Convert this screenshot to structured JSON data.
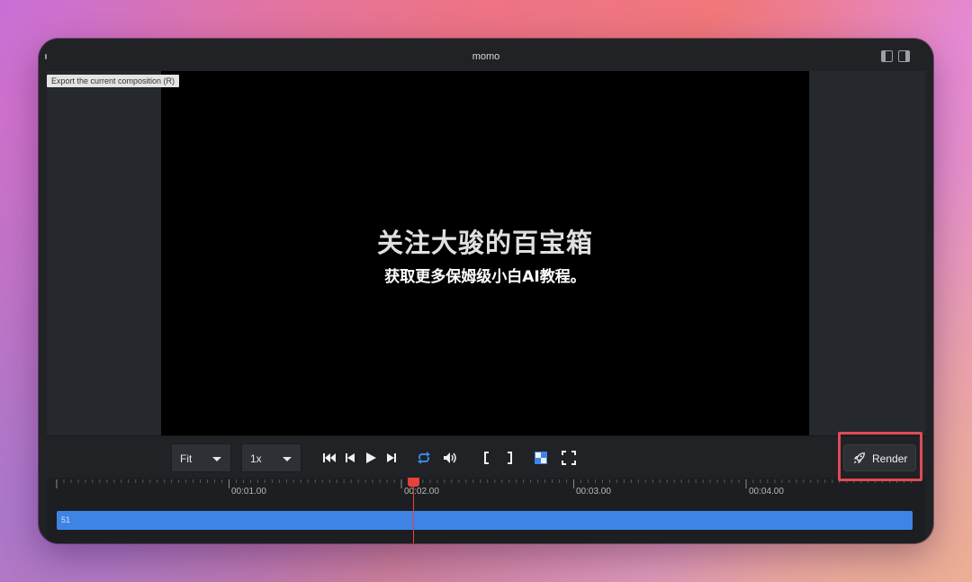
{
  "window": {
    "title": "momo"
  },
  "tooltip": {
    "text": "Export the current composition (R)"
  },
  "preview": {
    "title": "关注大骏的百宝箱",
    "subtitle": "获取更多保姆级小白AI教程。"
  },
  "controls": {
    "size_select": "Fit",
    "speed_select": "1x",
    "render_label": "Render",
    "accent_color": "#3f84e5"
  },
  "timeline": {
    "ticks": [
      "00:01.00",
      "00:02.00",
      "00:03.00",
      "00:04.00"
    ],
    "track_label": "51",
    "track_color": "#3f84e5",
    "playhead_color": "#e5433a"
  },
  "icons": {
    "layout_left": "sidebar-left-icon",
    "layout_right": "sidebar-right-icon",
    "first_frame": "skip-to-start-icon",
    "prev_frame": "step-back-icon",
    "play": "play-icon",
    "next_frame": "step-forward-icon",
    "loop": "loop-icon",
    "volume": "volume-icon",
    "in_point": "in-point-bracket-icon",
    "out_point": "out-point-bracket-icon",
    "checkerboard": "checkerboard-icon",
    "fullscreen": "fullscreen-icon",
    "render": "rocket-icon"
  }
}
